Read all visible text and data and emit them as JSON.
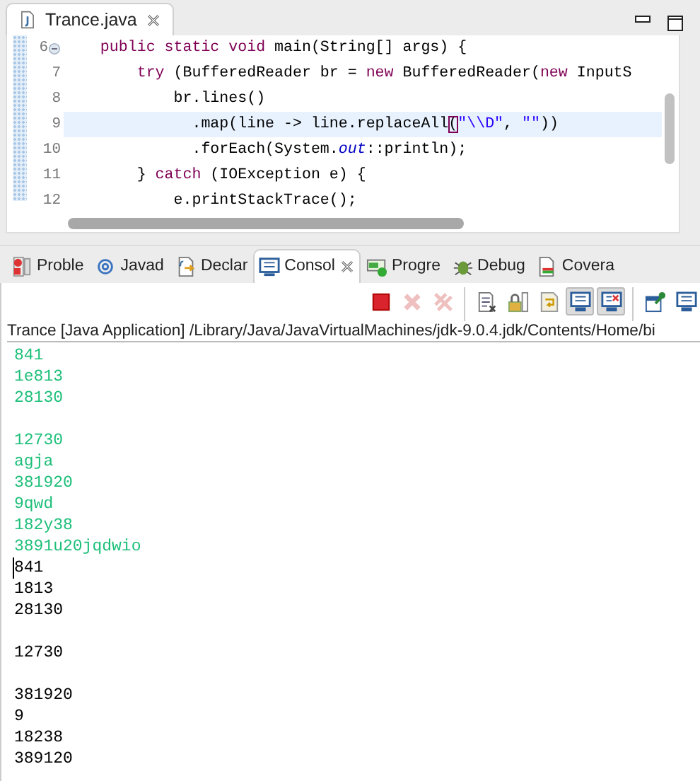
{
  "editor": {
    "tab": {
      "title": "Trance.java",
      "selected": true
    },
    "lines": [
      {
        "number": "6",
        "fold": true,
        "current": false,
        "segments": [
          {
            "kind": "kw",
            "text": "    public static void"
          },
          {
            "kind": "plain",
            "text": " main(String[] args) {"
          }
        ]
      },
      {
        "number": "7",
        "fold": false,
        "current": false,
        "segments": [
          {
            "kind": "kw",
            "text": "        try"
          },
          {
            "kind": "plain",
            "text": " (BufferedReader br = "
          },
          {
            "kind": "kw",
            "text": "new"
          },
          {
            "kind": "plain",
            "text": " BufferedReader("
          },
          {
            "kind": "kw",
            "text": "new"
          },
          {
            "kind": "plain",
            "text": " InputS"
          }
        ]
      },
      {
        "number": "8",
        "fold": false,
        "current": false,
        "segments": [
          {
            "kind": "plain",
            "text": "            br.lines()"
          }
        ]
      },
      {
        "number": "9",
        "fold": false,
        "current": true,
        "segments": [
          {
            "kind": "plain",
            "text": "              .map(line -> line.replaceAll"
          },
          {
            "kind": "match",
            "text": "("
          },
          {
            "kind": "str",
            "text": "\"\\\\D\""
          },
          {
            "kind": "plain",
            "text": ", "
          },
          {
            "kind": "str",
            "text": "\"\""
          },
          {
            "kind": "plain",
            "text": "))"
          }
        ]
      },
      {
        "number": "10",
        "fold": false,
        "current": false,
        "segments": [
          {
            "kind": "plain",
            "text": "              .forEach(System."
          },
          {
            "kind": "field",
            "text": "out"
          },
          {
            "kind": "plain",
            "text": "::println);"
          }
        ]
      },
      {
        "number": "11",
        "fold": false,
        "current": false,
        "segments": [
          {
            "kind": "plain",
            "text": "        } "
          },
          {
            "kind": "kw",
            "text": "catch"
          },
          {
            "kind": "plain",
            "text": " (IOException e) {"
          }
        ]
      },
      {
        "number": "12",
        "fold": false,
        "current": false,
        "segments": [
          {
            "kind": "plain",
            "text": "            e.printStackTrace();"
          }
        ]
      }
    ]
  },
  "views": {
    "tabs": [
      {
        "label": "Proble",
        "kind": "problems",
        "selected": false
      },
      {
        "label": "Javad",
        "kind": "javadoc",
        "selected": false
      },
      {
        "label": "Declar",
        "kind": "declaration",
        "selected": false
      },
      {
        "label": "Consol",
        "kind": "console",
        "selected": true
      },
      {
        "label": "Progre",
        "kind": "progress",
        "selected": false
      },
      {
        "label": "Debug",
        "kind": "debug",
        "selected": false
      },
      {
        "label": "Covera",
        "kind": "coverage",
        "selected": false
      }
    ],
    "toolbar": [
      {
        "kind": "terminate",
        "disabled": false,
        "pressed": false
      },
      {
        "kind": "remove",
        "disabled": true,
        "pressed": false
      },
      {
        "kind": "remove-all",
        "disabled": true,
        "pressed": false
      },
      {
        "kind": "clear",
        "disabled": false,
        "pressed": false
      },
      {
        "kind": "scroll-lock",
        "disabled": false,
        "pressed": false
      },
      {
        "kind": "word-wrap",
        "disabled": false,
        "pressed": false
      },
      {
        "kind": "stdout",
        "disabled": false,
        "pressed": true
      },
      {
        "kind": "stderr",
        "disabled": false,
        "pressed": true
      },
      {
        "kind": "pin",
        "disabled": false,
        "pressed": false
      },
      {
        "kind": "display",
        "disabled": false,
        "pressed": false
      }
    ],
    "console": {
      "title": "Trance [Java Application] /Library/Java/JavaVirtualMachines/jdk-9.0.4.jdk/Contents/Home/bi",
      "output": [
        {
          "kind": "input",
          "text": "841"
        },
        {
          "kind": "input",
          "text": "1e813"
        },
        {
          "kind": "input",
          "text": "28130"
        },
        {
          "kind": "blank"
        },
        {
          "kind": "input",
          "text": "12730"
        },
        {
          "kind": "input",
          "text": "agja"
        },
        {
          "kind": "input",
          "text": "381920"
        },
        {
          "kind": "input",
          "text": "9qwd"
        },
        {
          "kind": "input",
          "text": "182y38"
        },
        {
          "kind": "input",
          "text": "3891u20jqdwio"
        },
        {
          "kind": "output",
          "text": "841",
          "caret": true
        },
        {
          "kind": "output",
          "text": "1813"
        },
        {
          "kind": "output",
          "text": "28130"
        },
        {
          "kind": "blank"
        },
        {
          "kind": "output",
          "text": "12730"
        },
        {
          "kind": "blank"
        },
        {
          "kind": "output",
          "text": "381920"
        },
        {
          "kind": "output",
          "text": "9"
        },
        {
          "kind": "output",
          "text": "18238"
        },
        {
          "kind": "output",
          "text": "389120"
        }
      ]
    }
  }
}
